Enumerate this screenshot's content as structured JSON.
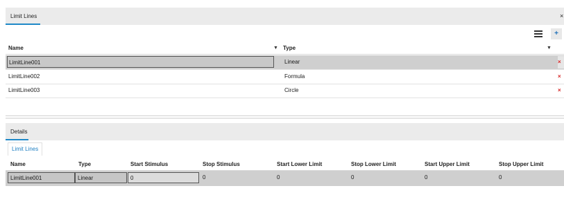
{
  "limit_lines_panel": {
    "tab_label": "Limit Lines",
    "close_glyph": "×",
    "menu_icon": "hamburger-menu-icon",
    "add_label": "+",
    "columns": {
      "name": "Name",
      "type": "Type"
    },
    "filter_glyph": "▼",
    "rows": [
      {
        "name": "LimitLine001",
        "type": "Linear",
        "delete": "×"
      },
      {
        "name": "LimitLine002",
        "type": "Formula",
        "delete": "×"
      },
      {
        "name": "LimitLine003",
        "type": "Circle",
        "delete": "×"
      }
    ]
  },
  "details_panel": {
    "tab_label": "Details",
    "subtab_label": "Limit Lines",
    "columns": {
      "name": "Name",
      "type": "Type",
      "start_stimulus": "Start Stimulus",
      "stop_stimulus": "Stop Stimulus",
      "start_lower_limit": "Start Lower Limit",
      "stop_lower_limit": "Stop Lower Limit",
      "start_upper_limit": "Start Upper Limit",
      "stop_upper_limit": "Stop Upper Limit"
    },
    "row": {
      "name": "LimitLine001",
      "type": "Linear",
      "start_stimulus": "0",
      "stop_stimulus": "0",
      "start_lower_limit": "0",
      "stop_lower_limit": "0",
      "start_upper_limit": "0",
      "stop_upper_limit": "0"
    }
  },
  "colors": {
    "accent": "#1e88c7",
    "selected_row": "#cfcfcf",
    "delete": "#d42020"
  }
}
